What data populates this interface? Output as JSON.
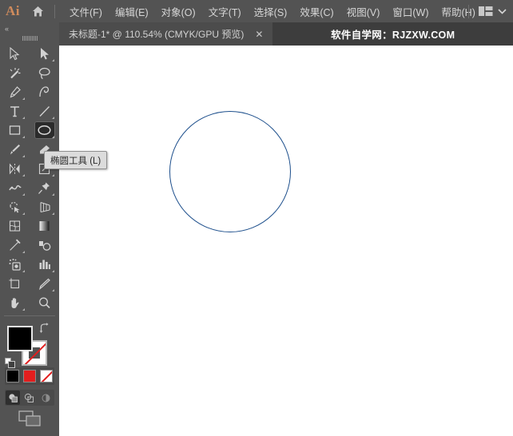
{
  "app": {
    "logo_text": "Ai",
    "home_icon": "home-icon",
    "workspace_icon": "workspace-layout-icon",
    "workspace_chevron": "chevron-down-icon"
  },
  "menubar": {
    "items": [
      {
        "label": "文件(F)",
        "name": "menu-file"
      },
      {
        "label": "编辑(E)",
        "name": "menu-edit"
      },
      {
        "label": "对象(O)",
        "name": "menu-object"
      },
      {
        "label": "文字(T)",
        "name": "menu-type"
      },
      {
        "label": "选择(S)",
        "name": "menu-select"
      },
      {
        "label": "效果(C)",
        "name": "menu-effect"
      },
      {
        "label": "视图(V)",
        "name": "menu-view"
      },
      {
        "label": "窗口(W)",
        "name": "menu-window"
      },
      {
        "label": "帮助(H)",
        "name": "menu-help"
      }
    ]
  },
  "tabbar": {
    "document_title": "未标题-1* @ 110.54% (CMYK/GPU 预览)",
    "close_label": "✕",
    "watermark": "软件自学网：RJZXW.COM"
  },
  "toolpanel": {
    "collapse_label": "«",
    "tools": [
      {
        "name": "selection-tool",
        "icon": "arrow-cursor-icon",
        "has_flyout": false,
        "selected": false
      },
      {
        "name": "direct-selection-tool",
        "icon": "white-arrow-cursor-icon",
        "has_flyout": true,
        "selected": false
      },
      {
        "name": "magic-wand-tool",
        "icon": "magic-wand-icon",
        "has_flyout": false,
        "selected": false
      },
      {
        "name": "lasso-tool",
        "icon": "lasso-icon",
        "has_flyout": false,
        "selected": false
      },
      {
        "name": "pen-tool",
        "icon": "pen-nib-icon",
        "has_flyout": true,
        "selected": false
      },
      {
        "name": "curvature-tool",
        "icon": "curvature-icon",
        "has_flyout": false,
        "selected": false
      },
      {
        "name": "type-tool",
        "icon": "type-t-icon",
        "has_flyout": true,
        "selected": false
      },
      {
        "name": "line-segment-tool",
        "icon": "line-segment-icon",
        "has_flyout": true,
        "selected": false
      },
      {
        "name": "rectangle-tool",
        "icon": "rectangle-icon",
        "has_flyout": true,
        "selected": false
      },
      {
        "name": "ellipse-tool",
        "icon": "ellipse-icon",
        "has_flyout": true,
        "selected": true
      },
      {
        "name": "paintbrush-tool",
        "icon": "paintbrush-icon",
        "has_flyout": true,
        "selected": false
      },
      {
        "name": "shaper-tool",
        "icon": "shaper-eraser-icon",
        "has_flyout": true,
        "selected": false
      },
      {
        "name": "reflect-tool",
        "icon": "reflect-icon",
        "has_flyout": true,
        "selected": false
      },
      {
        "name": "scale-tool",
        "icon": "scale-transform-icon",
        "has_flyout": true,
        "selected": false
      },
      {
        "name": "width-tool",
        "icon": "width-warp-icon",
        "has_flyout": true,
        "selected": false
      },
      {
        "name": "free-transform-tool",
        "icon": "pushpin-icon",
        "has_flyout": true,
        "selected": false
      },
      {
        "name": "shape-builder-tool",
        "icon": "shape-builder-icon",
        "has_flyout": true,
        "selected": false
      },
      {
        "name": "perspective-grid-tool",
        "icon": "perspective-grid-icon",
        "has_flyout": true,
        "selected": false
      },
      {
        "name": "mesh-tool",
        "icon": "mesh-icon",
        "has_flyout": false,
        "selected": false
      },
      {
        "name": "gradient-tool",
        "icon": "gradient-icon",
        "has_flyout": false,
        "selected": false
      },
      {
        "name": "eyedropper-tool",
        "icon": "eyedropper-icon",
        "has_flyout": true,
        "selected": false
      },
      {
        "name": "blend-tool",
        "icon": "blend-icon",
        "has_flyout": false,
        "selected": false
      },
      {
        "name": "symbol-sprayer-tool",
        "icon": "symbol-sprayer-icon",
        "has_flyout": true,
        "selected": false
      },
      {
        "name": "column-graph-tool",
        "icon": "bar-chart-icon",
        "has_flyout": true,
        "selected": false
      },
      {
        "name": "artboard-tool",
        "icon": "artboard-icon",
        "has_flyout": false,
        "selected": false
      },
      {
        "name": "slice-tool",
        "icon": "slice-knife-icon",
        "has_flyout": true,
        "selected": false
      },
      {
        "name": "hand-tool",
        "icon": "hand-icon",
        "has_flyout": true,
        "selected": false
      },
      {
        "name": "zoom-tool",
        "icon": "magnifier-icon",
        "has_flyout": false,
        "selected": false
      }
    ],
    "fill_color": "#000000",
    "stroke_color": "none",
    "swap_icon": "swap-fill-stroke-icon",
    "default_icon": "default-fill-stroke-icon",
    "swatches": [
      {
        "name": "color-swatch-black",
        "color": "#000000"
      },
      {
        "name": "color-swatch-red",
        "color": "#e21e1e"
      },
      {
        "name": "color-swatch-none",
        "color": "none"
      }
    ],
    "draw_modes": [
      {
        "name": "draw-normal-mode",
        "selected": true
      },
      {
        "name": "draw-behind-mode",
        "selected": false
      },
      {
        "name": "draw-inside-mode",
        "selected": false
      }
    ],
    "screen_mode_icon": "change-screen-mode-icon"
  },
  "tooltip": {
    "text": "椭圆工具 (L)"
  },
  "canvas": {
    "background": "#ffffff",
    "shape": {
      "name": "ellipse-shape",
      "type": "circle",
      "stroke_color": "#1d4f8c",
      "fill": "none"
    }
  }
}
